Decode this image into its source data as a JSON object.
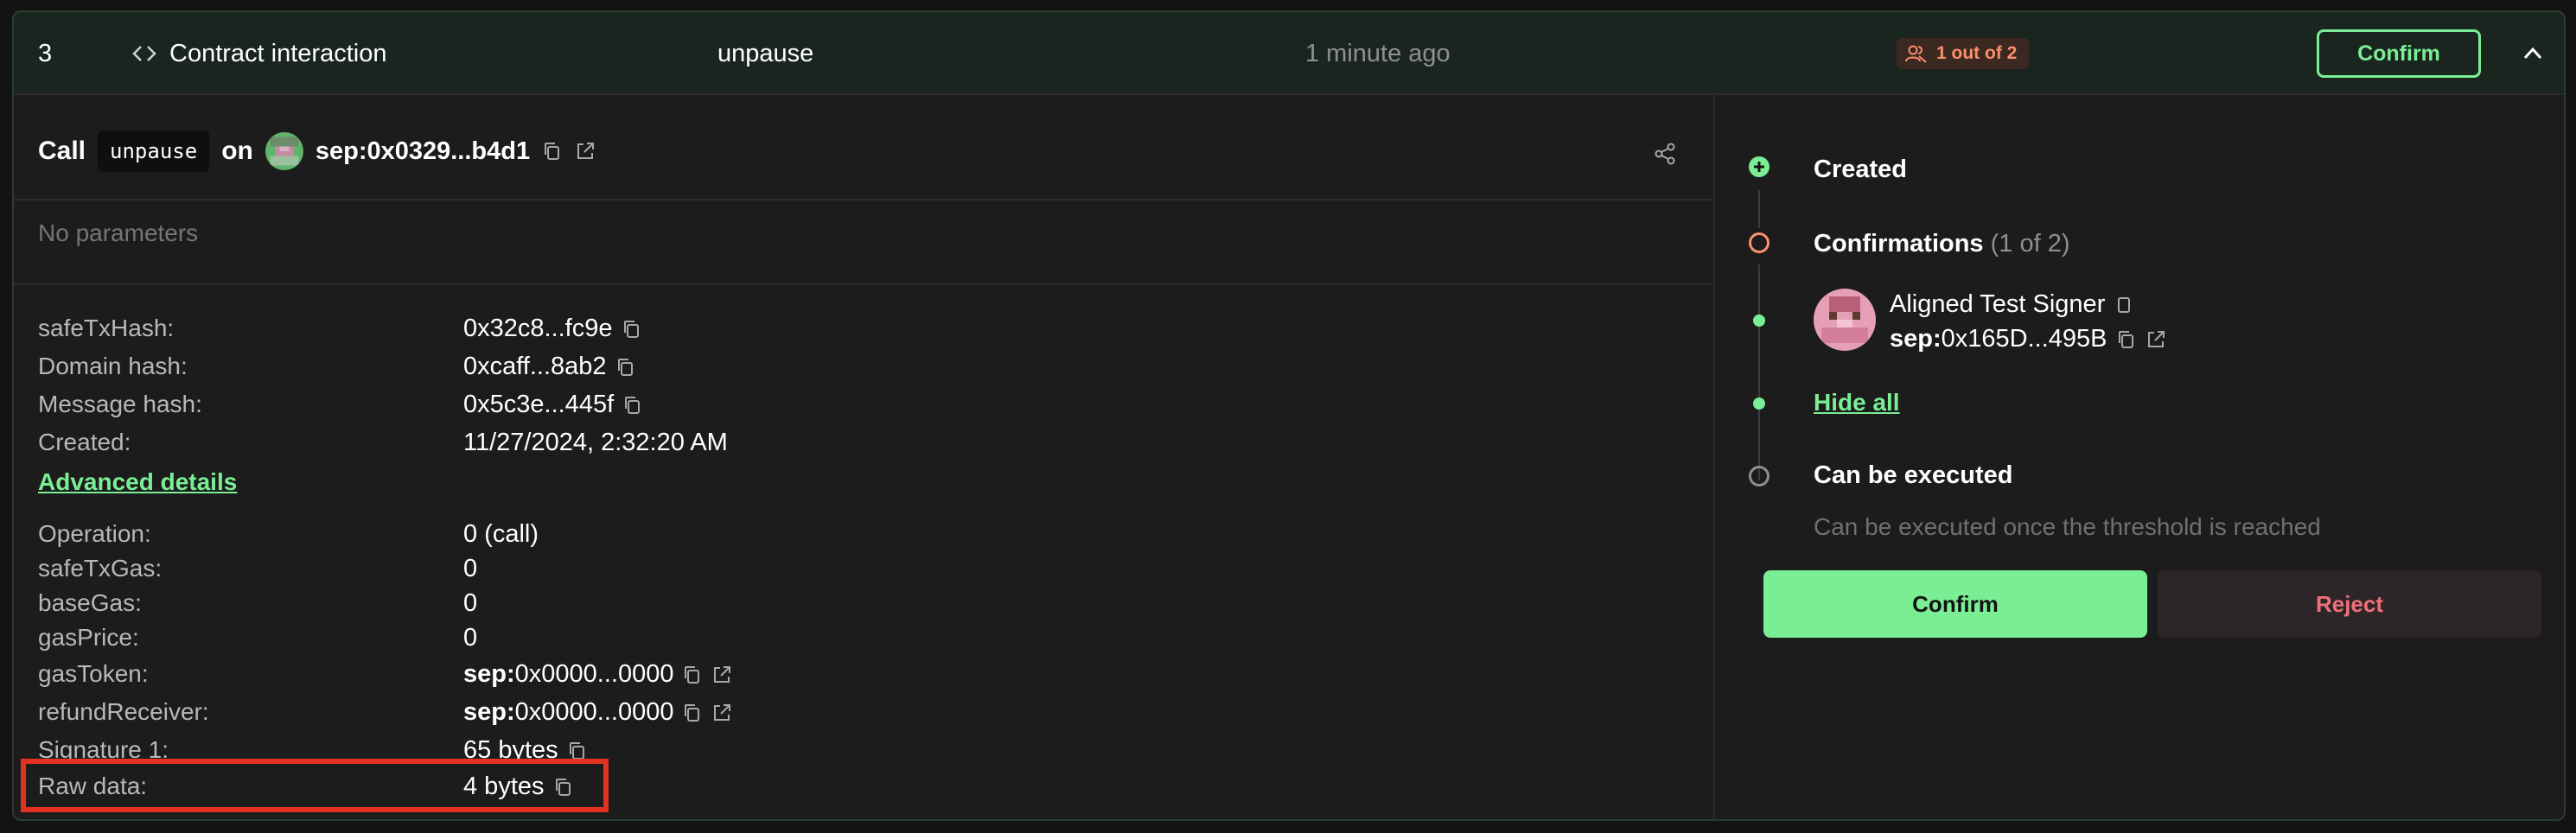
{
  "colors": {
    "accent": "#7aee94",
    "warning": "#fd8f6c",
    "danger": "#f0707a",
    "highlight": "#e3321f"
  },
  "header": {
    "number": "3",
    "type_icon": "code-icon",
    "type_label": "Contract interaction",
    "method": "unpause",
    "time": "1 minute ago",
    "badge_icon": "signers-icon",
    "badge_label": "1 out of 2",
    "confirm_label": "Confirm",
    "collapse_icon": "chevron-up-icon"
  },
  "call": {
    "prefix": "Call",
    "method": "unpause",
    "on": "on",
    "address_prefix": "sep:",
    "address": "0x0329...b4d1"
  },
  "params_text": "No parameters",
  "details": [
    {
      "label": "safeTxHash:",
      "value": "0x32c8...fc9e"
    },
    {
      "label": "Domain hash:",
      "value": "0xcaff...8ab2"
    },
    {
      "label": "Message hash:",
      "value": "0x5c3e...445f"
    },
    {
      "label": "Created:",
      "value": "11/27/2024, 2:32:20 AM"
    }
  ],
  "advanced_label": "Advanced details",
  "advanced": [
    {
      "label": "Operation:",
      "value": "0 (call)"
    },
    {
      "label": "safeTxGas:",
      "value": "0"
    },
    {
      "label": "baseGas:",
      "value": "0"
    },
    {
      "label": "gasPrice:",
      "value": "0"
    },
    {
      "label": "gasToken:",
      "prefix": "sep:",
      "value": "0x0000...0000"
    },
    {
      "label": "refundReceiver:",
      "prefix": "sep:",
      "value": "0x0000...0000"
    },
    {
      "label": "Signature 1:",
      "value": "65 bytes"
    },
    {
      "label": "Raw data:",
      "value": "4 bytes"
    }
  ],
  "timeline": {
    "created": "Created",
    "confirmations": "Confirmations",
    "confirmations_count": "(1 of 2)",
    "signer_name": "Aligned Test Signer",
    "signer_prefix": "sep:",
    "signer_address": "0x165D...495B",
    "hide_all": "Hide all",
    "executable": "Can be executed",
    "executable_note": "Can be executed once the threshold is reached"
  },
  "actions": {
    "confirm": "Confirm",
    "reject": "Reject"
  }
}
